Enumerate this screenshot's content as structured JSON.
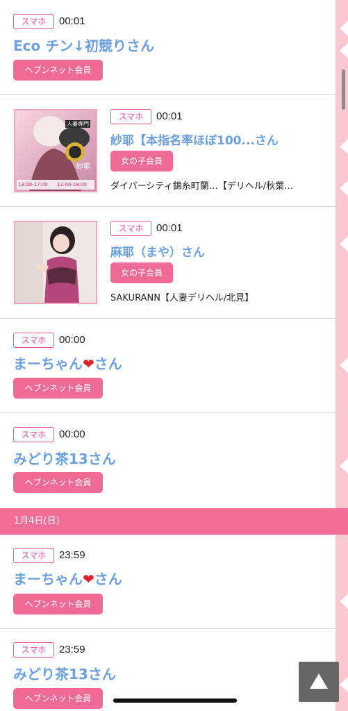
{
  "entries_top": [
    {
      "device": "スマホ",
      "time": "00:01",
      "name": "Eco チン↓初競りさん",
      "badge": "ヘブンネット会員"
    },
    {
      "device": "スマホ",
      "time": "00:01",
      "name": "紗耶【本指名率ほぼ100...さん",
      "badge": "女の子会員",
      "shop": "ダイバーシティ錦糸町蘭…【デリヘル/秋葉…"
    },
    {
      "device": "スマホ",
      "time": "00:01",
      "name": "麻耶（まや）さん",
      "badge": "女の子会員",
      "shop": "SAKURANN【人妻デリヘル/北見】"
    },
    {
      "device": "スマホ",
      "time": "00:00",
      "name_prefix": "まーちゃん",
      "heart": "❤",
      "name_suffix": "さん",
      "badge": "ヘブンネット会員"
    },
    {
      "device": "スマホ",
      "time": "00:00",
      "name": "みどり茶13さん",
      "badge": "ヘブンネット会員"
    }
  ],
  "date_separator": "1月4日(日)",
  "entries_bottom": [
    {
      "device": "スマホ",
      "time": "23:59",
      "name_prefix": "まーちゃん",
      "heart": "❤",
      "name_suffix": "さん",
      "badge": "ヘブンネット会員"
    },
    {
      "device": "スマホ",
      "time": "23:59",
      "name": "みどり茶13さん",
      "badge": "ヘブンネット会員"
    }
  ],
  "thumb1": {
    "lines": [
      "人妻専門",
      "紗耶",
      "13:00-17:00",
      "12:00-18:00"
    ]
  },
  "colors": {
    "accent_pink": "#f06a96",
    "date_bar": "#f46d96",
    "name_blue": "#6d9fdc",
    "tag_magenta": "#e0529a",
    "deco_strip": "#f8c7cf"
  },
  "icons": {
    "top_button": "triangle-up-icon"
  }
}
